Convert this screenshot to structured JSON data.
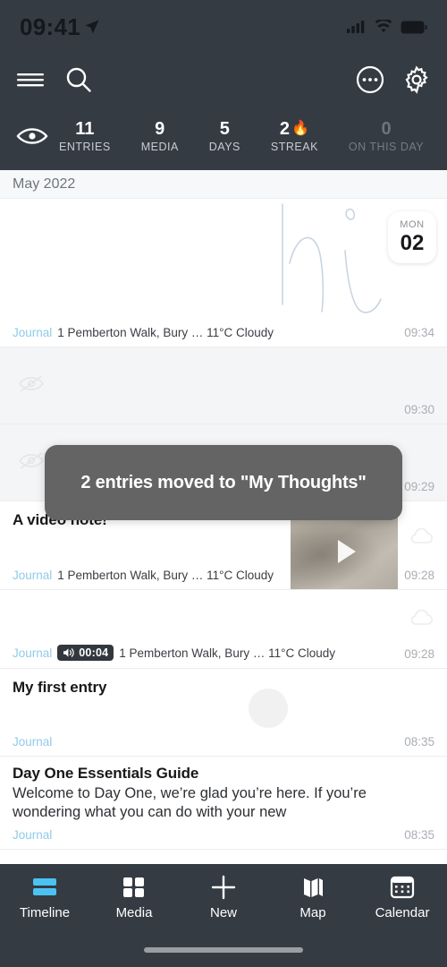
{
  "status_bar": {
    "time": "09:41",
    "location_icon": "location-arrow-icon",
    "cellular_icon": "cellular-signal-icon",
    "wifi_icon": "wifi-icon",
    "battery_icon": "battery-full-icon"
  },
  "nav": {
    "menu_icon": "hamburger-menu-icon",
    "search_icon": "search-icon",
    "more_icon": "more-options-icon",
    "settings_icon": "gear-icon"
  },
  "stats": {
    "eye_icon": "eye-visible-icon",
    "items": [
      {
        "value": "11",
        "label": "ENTRIES",
        "dim": false,
        "icon": ""
      },
      {
        "value": "9",
        "label": "MEDIA",
        "dim": false,
        "icon": ""
      },
      {
        "value": "5",
        "label": "DAYS",
        "dim": false,
        "icon": ""
      },
      {
        "value": "2",
        "label": "STREAK",
        "dim": false,
        "icon": "flame-icon"
      },
      {
        "value": "0",
        "label": "ON THIS DAY",
        "dim": true,
        "icon": ""
      }
    ]
  },
  "month_header": "May 2022",
  "entries": [
    {
      "title": "",
      "snippet": "",
      "journal": "Journal",
      "meta": "1 Pemberton Walk, Bury … 11°C Cloudy",
      "time": "09:34",
      "date_dow": "MON",
      "date_num": "02",
      "thumb": "drawing-sketch-thumbnail",
      "hidden": false
    },
    {
      "title": "",
      "snippet": "",
      "journal": "",
      "meta": "",
      "time": "09:30",
      "thumb": "",
      "hidden": true,
      "hidden_icon": "eye-hidden-icon"
    },
    {
      "title": "",
      "snippet": "",
      "journal": "",
      "meta": "",
      "time": "09:29",
      "thumb": "",
      "hidden": true,
      "hidden_icon": "eye-hidden-icon"
    },
    {
      "title": "A video note!",
      "snippet": "",
      "journal": "Journal",
      "meta": "1 Pemberton Walk, Bury … 11°C Cloudy",
      "time": "09:28",
      "thumb": "video-thumbnail",
      "play_icon": "play-icon",
      "sync_icon": "cloud-icon",
      "hidden": false
    },
    {
      "title": "",
      "snippet": "",
      "journal": "Journal",
      "audio_badge": {
        "icon": "speaker-icon",
        "duration": "00:04"
      },
      "meta": "1 Pemberton Walk, Bury … 11°C Cloudy",
      "time": "09:28",
      "sync_icon": "cloud-icon",
      "hidden": false
    },
    {
      "title": "My first entry",
      "snippet": "",
      "journal": "Journal",
      "meta": "",
      "time": "08:35",
      "hidden": false
    },
    {
      "title": "Day One Essentials Guide",
      "snippet": "Welcome to Day One, we’re glad you’re here. If you’re wondering what you can do with your new",
      "journal": "Journal",
      "meta": "",
      "time": "08:35",
      "hidden": false
    }
  ],
  "toast": {
    "message": "2 entries moved to \"My Thoughts\""
  },
  "tabbar": {
    "items": [
      {
        "label": "Timeline",
        "icon": "timeline-icon",
        "active": true
      },
      {
        "label": "Media",
        "icon": "grid-icon",
        "active": false
      },
      {
        "label": "New",
        "icon": "plus-icon",
        "active": false
      },
      {
        "label": "Map",
        "icon": "map-icon",
        "active": false
      },
      {
        "label": "Calendar",
        "icon": "calendar-icon",
        "active": false
      }
    ]
  },
  "colors": {
    "header_bg": "#343b43",
    "accent": "#4cc2f1",
    "journal_label": "#90cbe8",
    "toast_bg": "#646464"
  }
}
